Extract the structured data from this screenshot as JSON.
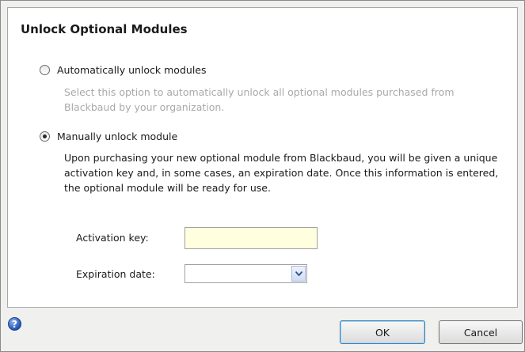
{
  "dialog": {
    "title": "Unlock Optional Modules",
    "options": [
      {
        "label": "Automatically unlock modules",
        "selected": false,
        "description": "Select this option to automatically unlock all optional modules purchased from Blackbaud by your organization."
      },
      {
        "label": "Manually unlock module",
        "selected": true,
        "description": "Upon purchasing your new optional module from Blackbaud, you will be given a unique activation key and, in some cases, an expiration date. Once this information is entered, the optional module will be ready for use."
      }
    ],
    "activation_key": {
      "label": "Activation key:",
      "value": ""
    },
    "expiration_date": {
      "label": "Expiration date:",
      "value": ""
    }
  },
  "footer": {
    "help_icon": "help-icon",
    "ok_label": "OK",
    "cancel_label": "Cancel"
  },
  "colors": {
    "input_highlight": "#ffffe0",
    "disabled_text": "#a9a9a9",
    "help_icon": "#2155b4"
  }
}
